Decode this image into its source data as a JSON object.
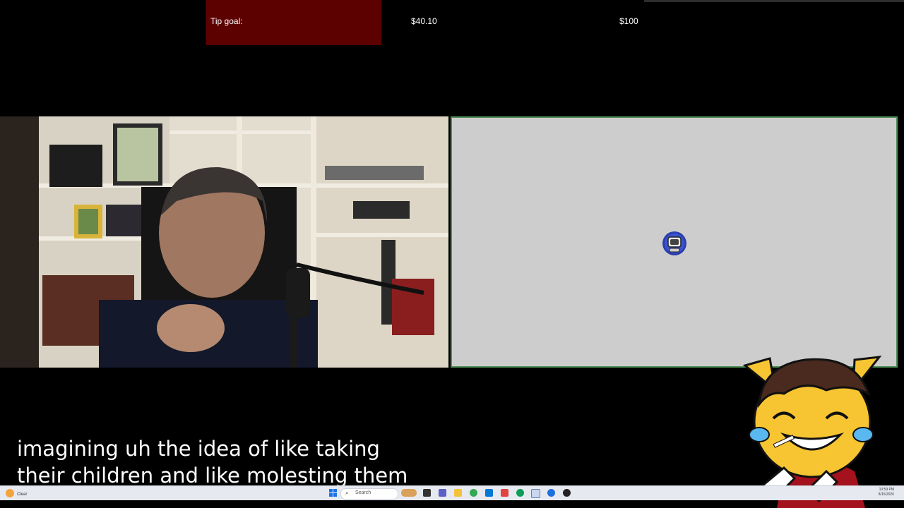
{
  "tip_goal": {
    "label": "Tip goal:",
    "current": "$40.10",
    "target": "$100",
    "progress_fraction": 0.401,
    "colors": {
      "fill": "#5c0000"
    }
  },
  "webcam": {
    "icon": "streamer-webcam-feed"
  },
  "screen_share": {
    "background": "#cdcdcd",
    "border": "#4f8f57",
    "center_icon": "app-logo-icon"
  },
  "mascot": {
    "icon": "crying-laughing-cat-mascot"
  },
  "captions": {
    "line1": "imagining uh the idea of like taking",
    "line2": "their children and like molesting them"
  },
  "taskbar": {
    "weather_text": "Clear",
    "search_placeholder": "Search",
    "time": "10:59 PM",
    "date": "8/15/2026",
    "icons": [
      "start-icon",
      "search-icon",
      "task-view-icon",
      "widgets-icon",
      "file-explorer-icon",
      "teams-icon",
      "edge-icon",
      "chrome-icon",
      "mail-icon",
      "store-icon",
      "photos-icon",
      "browser-icon",
      "app-icon"
    ]
  }
}
